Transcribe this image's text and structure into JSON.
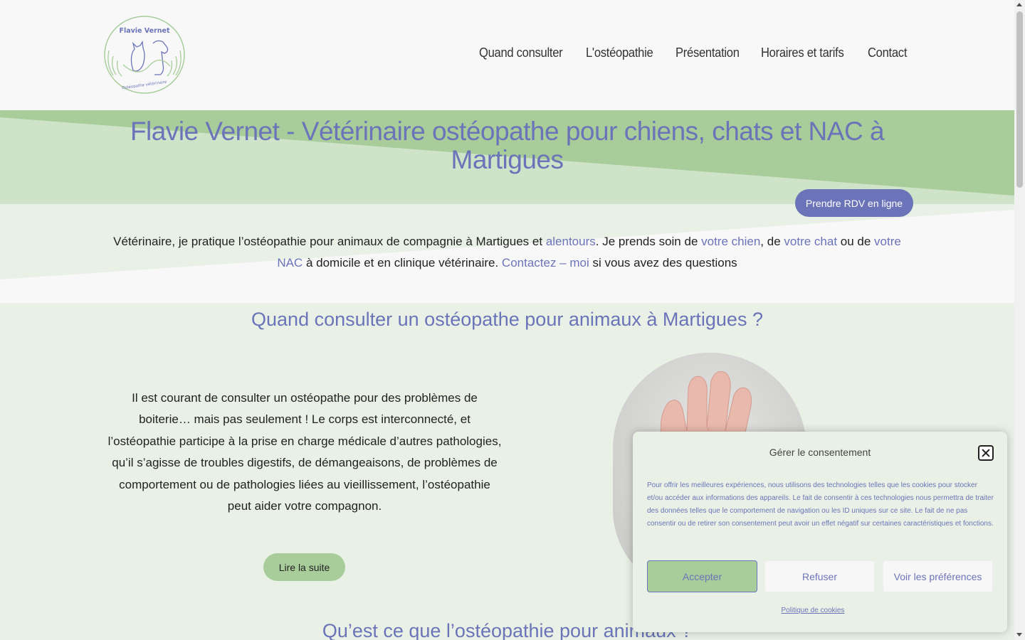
{
  "header": {
    "logo": {
      "name": "Flavie Vernet",
      "tagline": "Ostéopathe vétérinaire"
    },
    "nav": [
      {
        "label": "Quand consulter"
      },
      {
        "label": "L'ostéopathie"
      },
      {
        "label": "Présentation"
      },
      {
        "label": "Horaires et tarifs"
      },
      {
        "label": "Contact"
      }
    ]
  },
  "hero": {
    "title": "Flavie Vernet - Vétérinaire ostéopathe pour chiens, chats et NAC à Martigues",
    "rdv_button": "Prendre RDV en ligne",
    "text": {
      "p1": "Vétérinaire, je pratique l’ostéopathie pour animaux de compagnie à Martigues et ",
      "link_alentours": "alentours",
      "p2": ". Je prends soin de ",
      "link_chien": "votre chien",
      "p3": ", de ",
      "link_chat": "votre chat",
      "p4": " ou de ",
      "link_nac": "votre NAC",
      "p5": " à domicile et en clinique vétérinaire.  ",
      "link_contact": "Contactez – moi",
      "p6": " si vous avez des questions"
    }
  },
  "section2": {
    "title": "Quand consulter un ostéopathe pour animaux à Martigues ?",
    "text": "Il est courant de consulter un ostéopathe pour des problèmes de boiterie… mais pas seulement ! Le corps est interconnecté, et l’ostéopathie participe à la prise en charge médicale d’autres pathologies, qu’il s’agisse de troubles digestifs, de démangeaisons, de problèmes de comportement ou de pathologies liées au vieillissement, l’ostéopathie peut aider votre compagnon.",
    "button": "Lire la suite",
    "next_title": "Qu’est ce que l’ostéopathie pour animaux ?"
  },
  "cookie": {
    "title": "Gérer le consentement",
    "text": "Pour offrir les meilleures expériences, nous utilisons des technologies telles que les cookies pour stocker et/ou accéder aux informations des appareils. Le fait de consentir à ces technologies nous permettra de traiter des données telles que le comportement de navigation ou les ID uniques sur ce site. Le fait de ne pas consentir ou de retirer son consentement peut avoir un effet négatif sur certaines caractéristiques et fonctions.",
    "accept": "Accepter",
    "refuse": "Refuser",
    "preferences": "Voir les préférences",
    "policy": "Politique de cookies"
  },
  "colors": {
    "accent": "#6b74b8",
    "green": "#a8cd9b",
    "light_green": "#e9f1e6",
    "background": "#f8f8f8"
  }
}
